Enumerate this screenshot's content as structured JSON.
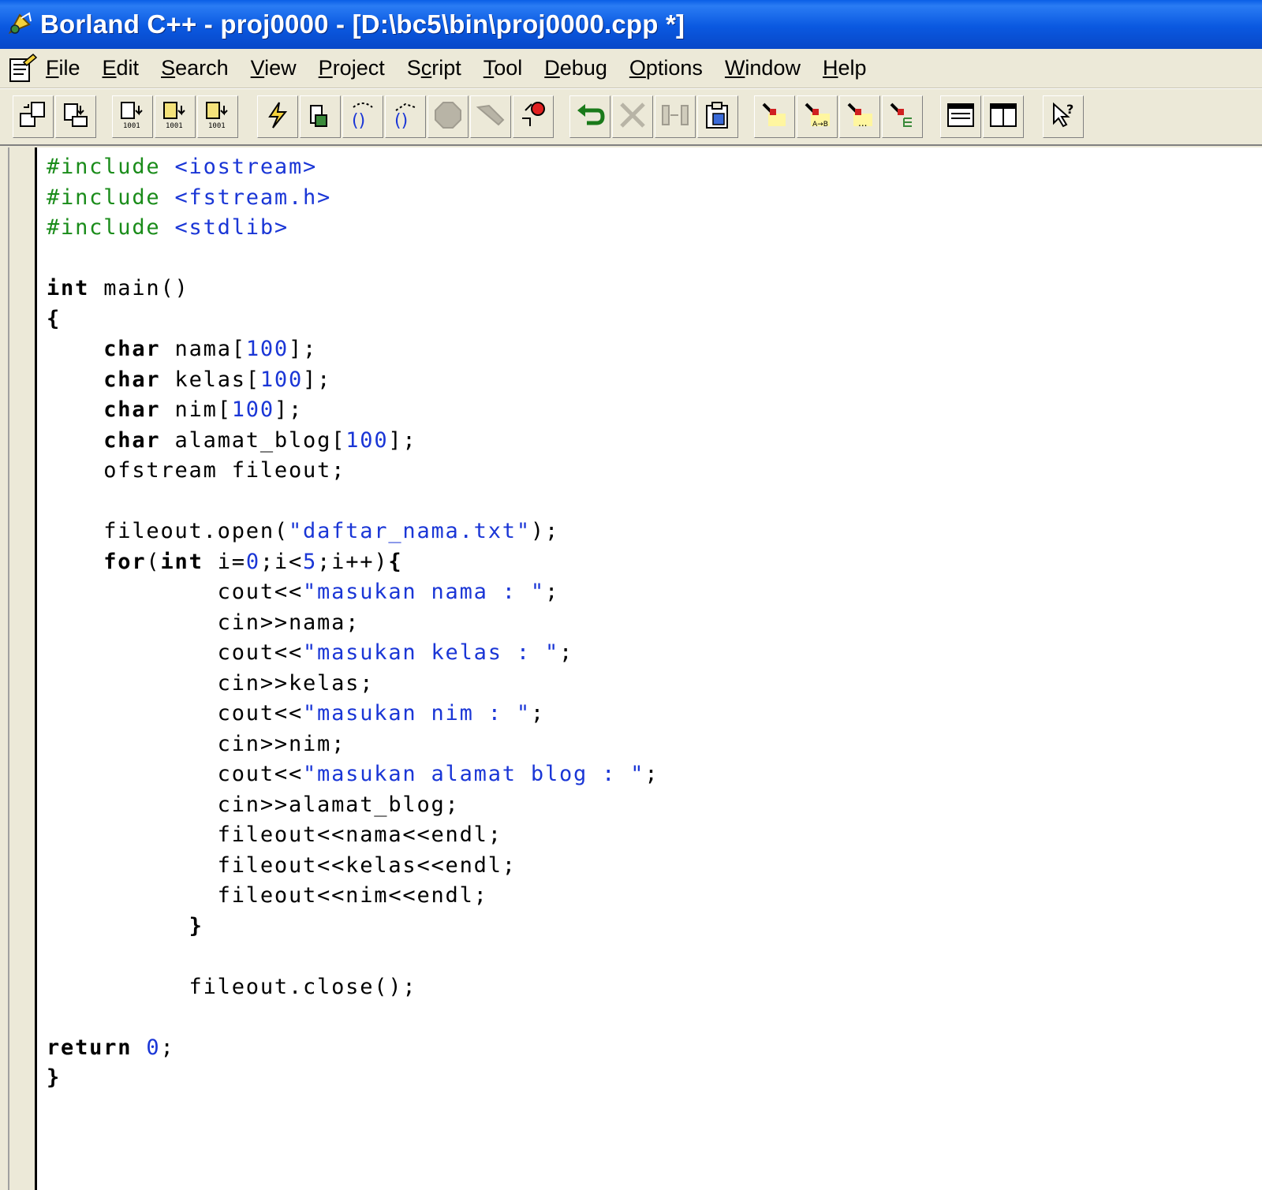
{
  "window": {
    "title": "Borland C++ - proj0000 - [D:\\bc5\\bin\\proj0000.cpp *]"
  },
  "menu": {
    "items": [
      {
        "key": "F",
        "rest": "ile"
      },
      {
        "key": "E",
        "rest": "dit"
      },
      {
        "key": "S",
        "rest": "earch"
      },
      {
        "key": "V",
        "rest": "iew"
      },
      {
        "key": "P",
        "rest": "roject"
      },
      {
        "pre": "S",
        "key": "c",
        "rest": "ript"
      },
      {
        "key": "T",
        "rest": "ool"
      },
      {
        "key": "D",
        "rest": "ebug"
      },
      {
        "key": "O",
        "rest": "ptions"
      },
      {
        "key": "W",
        "rest": "indow"
      },
      {
        "key": "H",
        "rest": "elp"
      }
    ]
  },
  "toolbar": {
    "groups": [
      [
        "new-project-icon",
        "open-file-icon"
      ],
      [
        "compile-icon",
        "make-icon",
        "build-all-icon"
      ],
      [
        "run-icon",
        "step-over-icon",
        "trace-into-icon",
        "statement-step-icon",
        "stop-icon",
        "pause-icon",
        "breakpoint-icon"
      ],
      [
        "undo-icon",
        "cut-icon",
        "replace-icon",
        "clipboard-icon"
      ],
      [
        "search-icon",
        "search-replace-icon",
        "search-again-icon",
        "browse-icon"
      ],
      [
        "window-tile-icon",
        "window-split-icon"
      ],
      [
        "help-pointer-icon"
      ]
    ]
  },
  "editor": {
    "lines": [
      [
        {
          "t": "#include ",
          "c": "pp"
        },
        {
          "t": "<iostream>",
          "c": "str"
        }
      ],
      [
        {
          "t": "#include ",
          "c": "pp"
        },
        {
          "t": "<fstream.h>",
          "c": "str"
        }
      ],
      [
        {
          "t": "#include ",
          "c": "pp"
        },
        {
          "t": "<stdlib>",
          "c": "str"
        }
      ],
      [],
      [
        {
          "t": "int",
          "c": "kw"
        },
        {
          "t": " main()"
        }
      ],
      [
        {
          "t": "{",
          "c": "kw"
        }
      ],
      [
        {
          "t": "    "
        },
        {
          "t": "char",
          "c": "kw"
        },
        {
          "t": " nama["
        },
        {
          "t": "100",
          "c": "num"
        },
        {
          "t": "];"
        }
      ],
      [
        {
          "t": "    "
        },
        {
          "t": "char",
          "c": "kw"
        },
        {
          "t": " kelas["
        },
        {
          "t": "100",
          "c": "num"
        },
        {
          "t": "];"
        }
      ],
      [
        {
          "t": "    "
        },
        {
          "t": "char",
          "c": "kw"
        },
        {
          "t": " nim["
        },
        {
          "t": "100",
          "c": "num"
        },
        {
          "t": "];"
        }
      ],
      [
        {
          "t": "    "
        },
        {
          "t": "char",
          "c": "kw"
        },
        {
          "t": " alamat_blog["
        },
        {
          "t": "100",
          "c": "num"
        },
        {
          "t": "];"
        }
      ],
      [
        {
          "t": "    ofstream fileout;"
        }
      ],
      [],
      [
        {
          "t": "    fileout.open("
        },
        {
          "t": "\"daftar_nama.txt\"",
          "c": "str"
        },
        {
          "t": ");"
        }
      ],
      [
        {
          "t": "    "
        },
        {
          "t": "for",
          "c": "kw"
        },
        {
          "t": "("
        },
        {
          "t": "int",
          "c": "kw"
        },
        {
          "t": " i="
        },
        {
          "t": "0",
          "c": "num"
        },
        {
          "t": ";i<"
        },
        {
          "t": "5",
          "c": "num"
        },
        {
          "t": ";i++)"
        },
        {
          "t": "{",
          "c": "kw"
        }
      ],
      [
        {
          "t": "            cout<<"
        },
        {
          "t": "\"masukan nama : \"",
          "c": "str"
        },
        {
          "t": ";"
        }
      ],
      [
        {
          "t": "            cin>>nama;"
        }
      ],
      [
        {
          "t": "            cout<<"
        },
        {
          "t": "\"masukan kelas : \"",
          "c": "str"
        },
        {
          "t": ";"
        }
      ],
      [
        {
          "t": "            cin>>kelas;"
        }
      ],
      [
        {
          "t": "            cout<<"
        },
        {
          "t": "\"masukan nim : \"",
          "c": "str"
        },
        {
          "t": ";"
        }
      ],
      [
        {
          "t": "            cin>>nim;"
        }
      ],
      [
        {
          "t": "            cout<<"
        },
        {
          "t": "\"masukan alamat blog : \"",
          "c": "str"
        },
        {
          "t": ";"
        }
      ],
      [
        {
          "t": "            cin>>alamat_blog;"
        }
      ],
      [
        {
          "t": "            fileout<<nama<<endl;"
        }
      ],
      [
        {
          "t": "            fileout<<kelas<<endl;"
        }
      ],
      [
        {
          "t": "            fileout<<nim<<endl;"
        }
      ],
      [
        {
          "t": "          "
        },
        {
          "t": "}",
          "c": "kw"
        }
      ],
      [],
      [
        {
          "t": "          fileout.close();"
        }
      ],
      [],
      [
        {
          "t": "return",
          "c": "kw"
        },
        {
          "t": " "
        },
        {
          "t": "0",
          "c": "num"
        },
        {
          "t": ";"
        }
      ],
      [
        {
          "t": "}",
          "c": "kw"
        }
      ]
    ]
  }
}
